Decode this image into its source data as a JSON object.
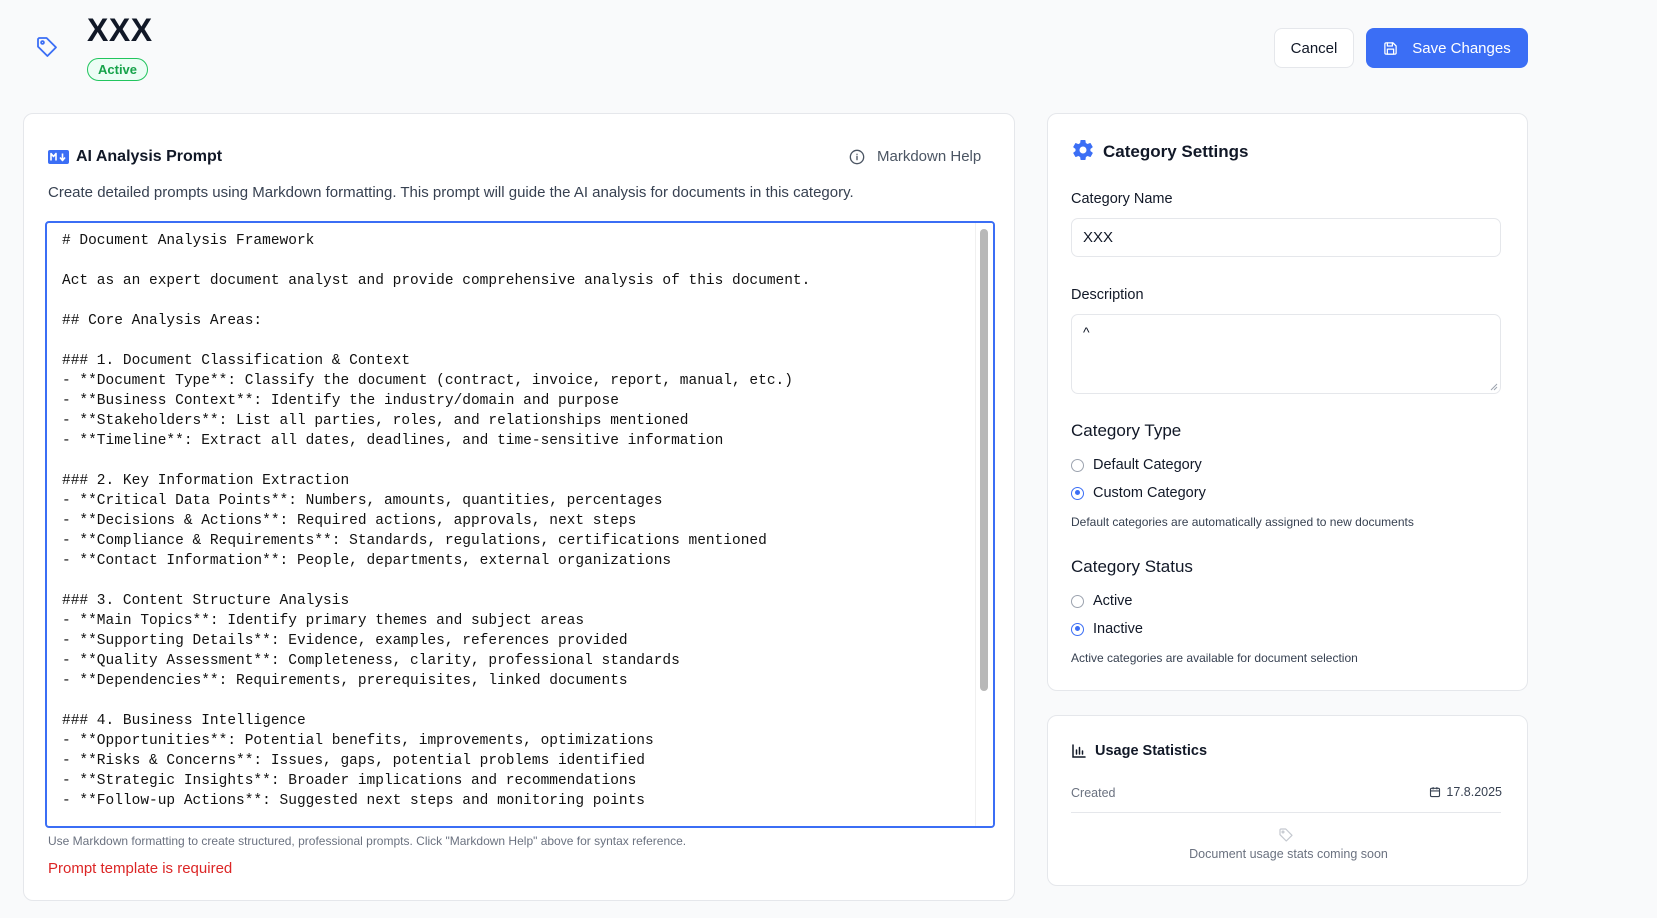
{
  "header": {
    "title": "XXX",
    "status_badge": "Active",
    "cancel_label": "Cancel",
    "save_label": "Save Changes",
    "icons": {
      "title": "tag-icon",
      "save": "save-icon"
    },
    "colors": {
      "primary": "#3b6ef5",
      "active_badge": "#16a34a"
    }
  },
  "prompt_card": {
    "title": "AI Analysis Prompt",
    "help_label": "Markdown Help",
    "description": "Create detailed prompts using Markdown formatting. This prompt will guide the AI analysis for documents in this category.",
    "editor_value": "# Document Analysis Framework\n\nAct as an expert document analyst and provide comprehensive analysis of this document.\n\n## Core Analysis Areas:\n\n### 1. Document Classification & Context\n- **Document Type**: Classify the document (contract, invoice, report, manual, etc.)\n- **Business Context**: Identify the industry/domain and purpose\n- **Stakeholders**: List all parties, roles, and relationships mentioned\n- **Timeline**: Extract all dates, deadlines, and time-sensitive information\n\n### 2. Key Information Extraction\n- **Critical Data Points**: Numbers, amounts, quantities, percentages\n- **Decisions & Actions**: Required actions, approvals, next steps\n- **Compliance & Requirements**: Standards, regulations, certifications mentioned\n- **Contact Information**: People, departments, external organizations\n\n### 3. Content Structure Analysis\n- **Main Topics**: Identify primary themes and subject areas\n- **Supporting Details**: Evidence, examples, references provided\n- **Quality Assessment**: Completeness, clarity, professional standards\n- **Dependencies**: Requirements, prerequisites, linked documents\n\n### 4. Business Intelligence\n- **Opportunities**: Potential benefits, improvements, optimizations\n- **Risks & Concerns**: Issues, gaps, potential problems identified\n- **Strategic Insights**: Broader implications and recommendations\n- **Follow-up Actions**: Suggested next steps and monitoring points",
    "hint": "Use Markdown formatting to create structured, professional prompts. Click \"Markdown Help\" above for syntax reference.",
    "error": "Prompt template is required",
    "icons": {
      "title": "markdown-icon",
      "help": "info-icon"
    },
    "colors": {
      "error": "#dc2626"
    }
  },
  "settings_card": {
    "title": "Category Settings",
    "name_label": "Category Name",
    "name_value": "XXX",
    "description_label": "Description",
    "description_value": "^",
    "type_title": "Category Type",
    "type_options": [
      {
        "label": "Default Category",
        "checked": false
      },
      {
        "label": "Custom Category",
        "checked": true
      }
    ],
    "type_help": "Default categories are automatically assigned to new documents",
    "status_title": "Category Status",
    "status_options": [
      {
        "label": "Active",
        "checked": false
      },
      {
        "label": "Inactive",
        "checked": true
      }
    ],
    "status_help": "Active categories are available for document selection",
    "icons": {
      "title": "gear-icon"
    }
  },
  "stats_card": {
    "title": "Usage Statistics",
    "created_label": "Created",
    "created_value": "17.8.2025",
    "coming_soon": "Document usage stats coming soon",
    "icons": {
      "title": "bar-chart-icon",
      "date": "calendar-icon",
      "placeholder": "tag-icon"
    }
  }
}
